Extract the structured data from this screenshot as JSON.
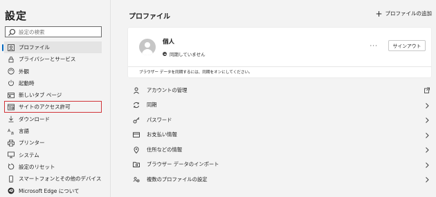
{
  "sidebar": {
    "title": "設定",
    "search": {
      "placeholder": "設定の検索",
      "value": ""
    },
    "items": [
      {
        "label": "プロファイル",
        "icon": "profile-icon"
      },
      {
        "label": "プライバシーとサービス",
        "icon": "lock-icon"
      },
      {
        "label": "外観",
        "icon": "palette-icon"
      },
      {
        "label": "起動時",
        "icon": "power-icon"
      },
      {
        "label": "新しいタブ ページ",
        "icon": "new-tab-icon"
      },
      {
        "label": "サイトのアクセス許可",
        "icon": "site-permissions-icon"
      },
      {
        "label": "ダウンロード",
        "icon": "download-icon"
      },
      {
        "label": "言語",
        "icon": "language-icon"
      },
      {
        "label": "プリンター",
        "icon": "printer-icon"
      },
      {
        "label": "システム",
        "icon": "system-icon"
      },
      {
        "label": "設定のリセット",
        "icon": "reset-icon"
      },
      {
        "label": "スマートフォンとその他のデバイス",
        "icon": "phone-icon"
      },
      {
        "label": "Microsoft Edge について",
        "icon": "edge-icon"
      }
    ]
  },
  "main": {
    "title": "プロファイル",
    "add_profile": "プロファイルの追加",
    "profile": {
      "name": "個人",
      "sync_status": "同期していません",
      "more": "···",
      "signin": "サインアウト",
      "note": "ブラウザー データを同期するには、同期をオンにしてください。"
    },
    "menu": [
      {
        "label": "アカウントの管理",
        "icon": "person-icon",
        "trailing": "external-link-icon"
      },
      {
        "label": "同期",
        "icon": "sync-icon",
        "trailing": "chevron-right-icon"
      },
      {
        "label": "パスワード",
        "icon": "key-icon",
        "trailing": "chevron-right-icon"
      },
      {
        "label": "お支払い情報",
        "icon": "credit-card-icon",
        "trailing": "chevron-right-icon"
      },
      {
        "label": "住所などの情報",
        "icon": "location-icon",
        "trailing": "chevron-right-icon"
      },
      {
        "label": "ブラウザー データのインポート",
        "icon": "import-icon",
        "trailing": "chevron-right-icon"
      },
      {
        "label": "複数のプロファイルの設定",
        "icon": "multi-profile-icon",
        "trailing": "chevron-right-icon"
      }
    ]
  },
  "colors": {
    "accent": "#0067c0",
    "highlight_border": "#d13438",
    "background": "#f3f3f3"
  }
}
